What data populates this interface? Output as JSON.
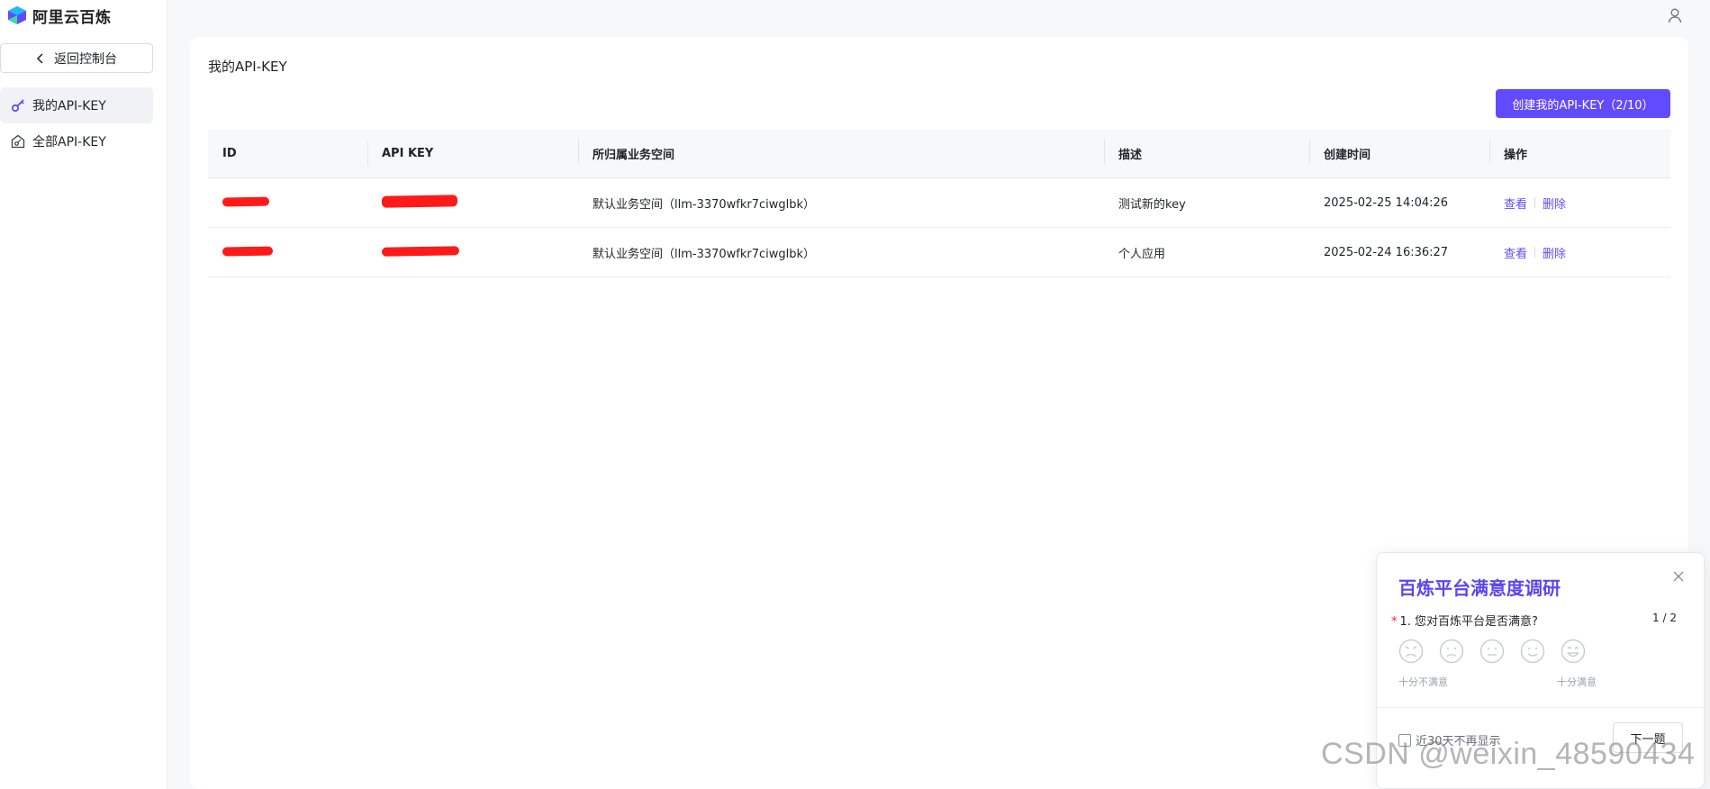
{
  "brand": {
    "name": "阿里云百炼",
    "logo_colors": [
      "#22b8ff",
      "#624aff",
      "#3ddc97"
    ]
  },
  "sidebar": {
    "back_label": "返回控制台",
    "items": [
      {
        "label": "我的API-KEY",
        "icon": "key-icon",
        "active": true
      },
      {
        "label": "全部API-KEY",
        "icon": "home-key-icon",
        "active": false
      }
    ]
  },
  "header": {
    "user_icon": "user-icon"
  },
  "main": {
    "title": "我的API-KEY",
    "create_button": "创建我的API-KEY（2/10）",
    "table": {
      "columns": [
        "ID",
        "API KEY",
        "所归属业务空间",
        "描述",
        "创建时间",
        "操作"
      ],
      "rows": [
        {
          "id": "",
          "api_key": "",
          "workspace": "默认业务空间（llm-3370wfkr7ciwglbk）",
          "description": "测试新的key",
          "created": "2025-02-25 14:04:26",
          "actions": [
            "查看",
            "删除"
          ]
        },
        {
          "id": "",
          "api_key": "",
          "workspace": "默认业务空间（llm-3370wfkr7ciwglbk）",
          "description": "个人应用",
          "created": "2025-02-24 16:36:27",
          "actions": [
            "查看",
            "删除"
          ]
        }
      ]
    }
  },
  "survey": {
    "title": "百炼平台满意度调研",
    "question": "1. 您对百炼平台是否满意?",
    "required_mark": "*",
    "page": "1 / 2",
    "scale_low": "十分不满意",
    "scale_high": "十分满意",
    "faces": [
      "very-sad-face-icon",
      "sad-face-icon",
      "neutral-face-icon",
      "smile-face-icon",
      "grin-face-icon"
    ],
    "checkbox_label": "近30天不再显示",
    "next_button": "下一题"
  },
  "watermark": "CSDN @weixin_48590434",
  "colors": {
    "accent": "#624aff",
    "survey_title": "#5b47f0",
    "redaction": "#ff1a1a"
  }
}
